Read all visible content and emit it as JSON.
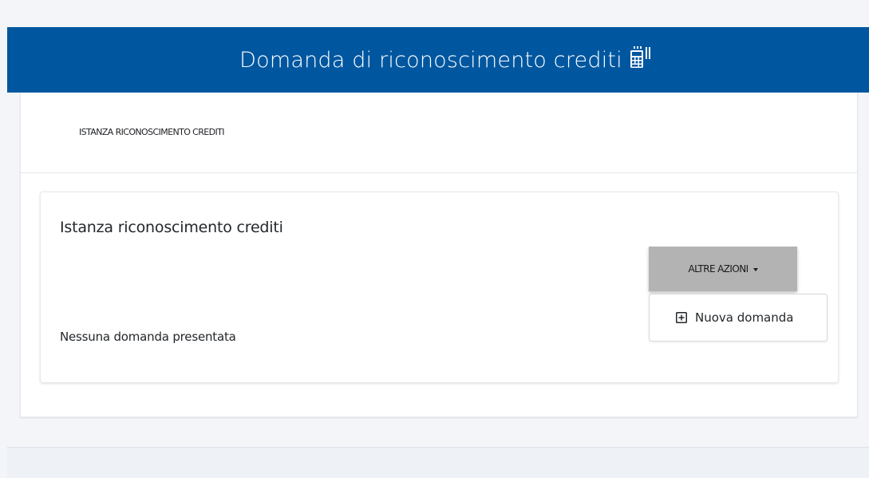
{
  "header": {
    "title": "Domanda di riconoscimento crediti",
    "icon": "calculator-icon"
  },
  "breadcrumb": {
    "label": "ISTANZA RICONOSCIMENTO CREDITI"
  },
  "card": {
    "title": "Istanza riconoscimento crediti",
    "empty_message": "Nessuna domanda presentata"
  },
  "actions": {
    "button_label": "ALTRE AZIONI",
    "menu_items": [
      {
        "label": "Nuova domanda",
        "icon": "plus-square-icon"
      }
    ]
  },
  "colors": {
    "header_bg": "#0057a0",
    "button_bg": "#b3b3b3",
    "page_bg": "#f3f5f9"
  }
}
